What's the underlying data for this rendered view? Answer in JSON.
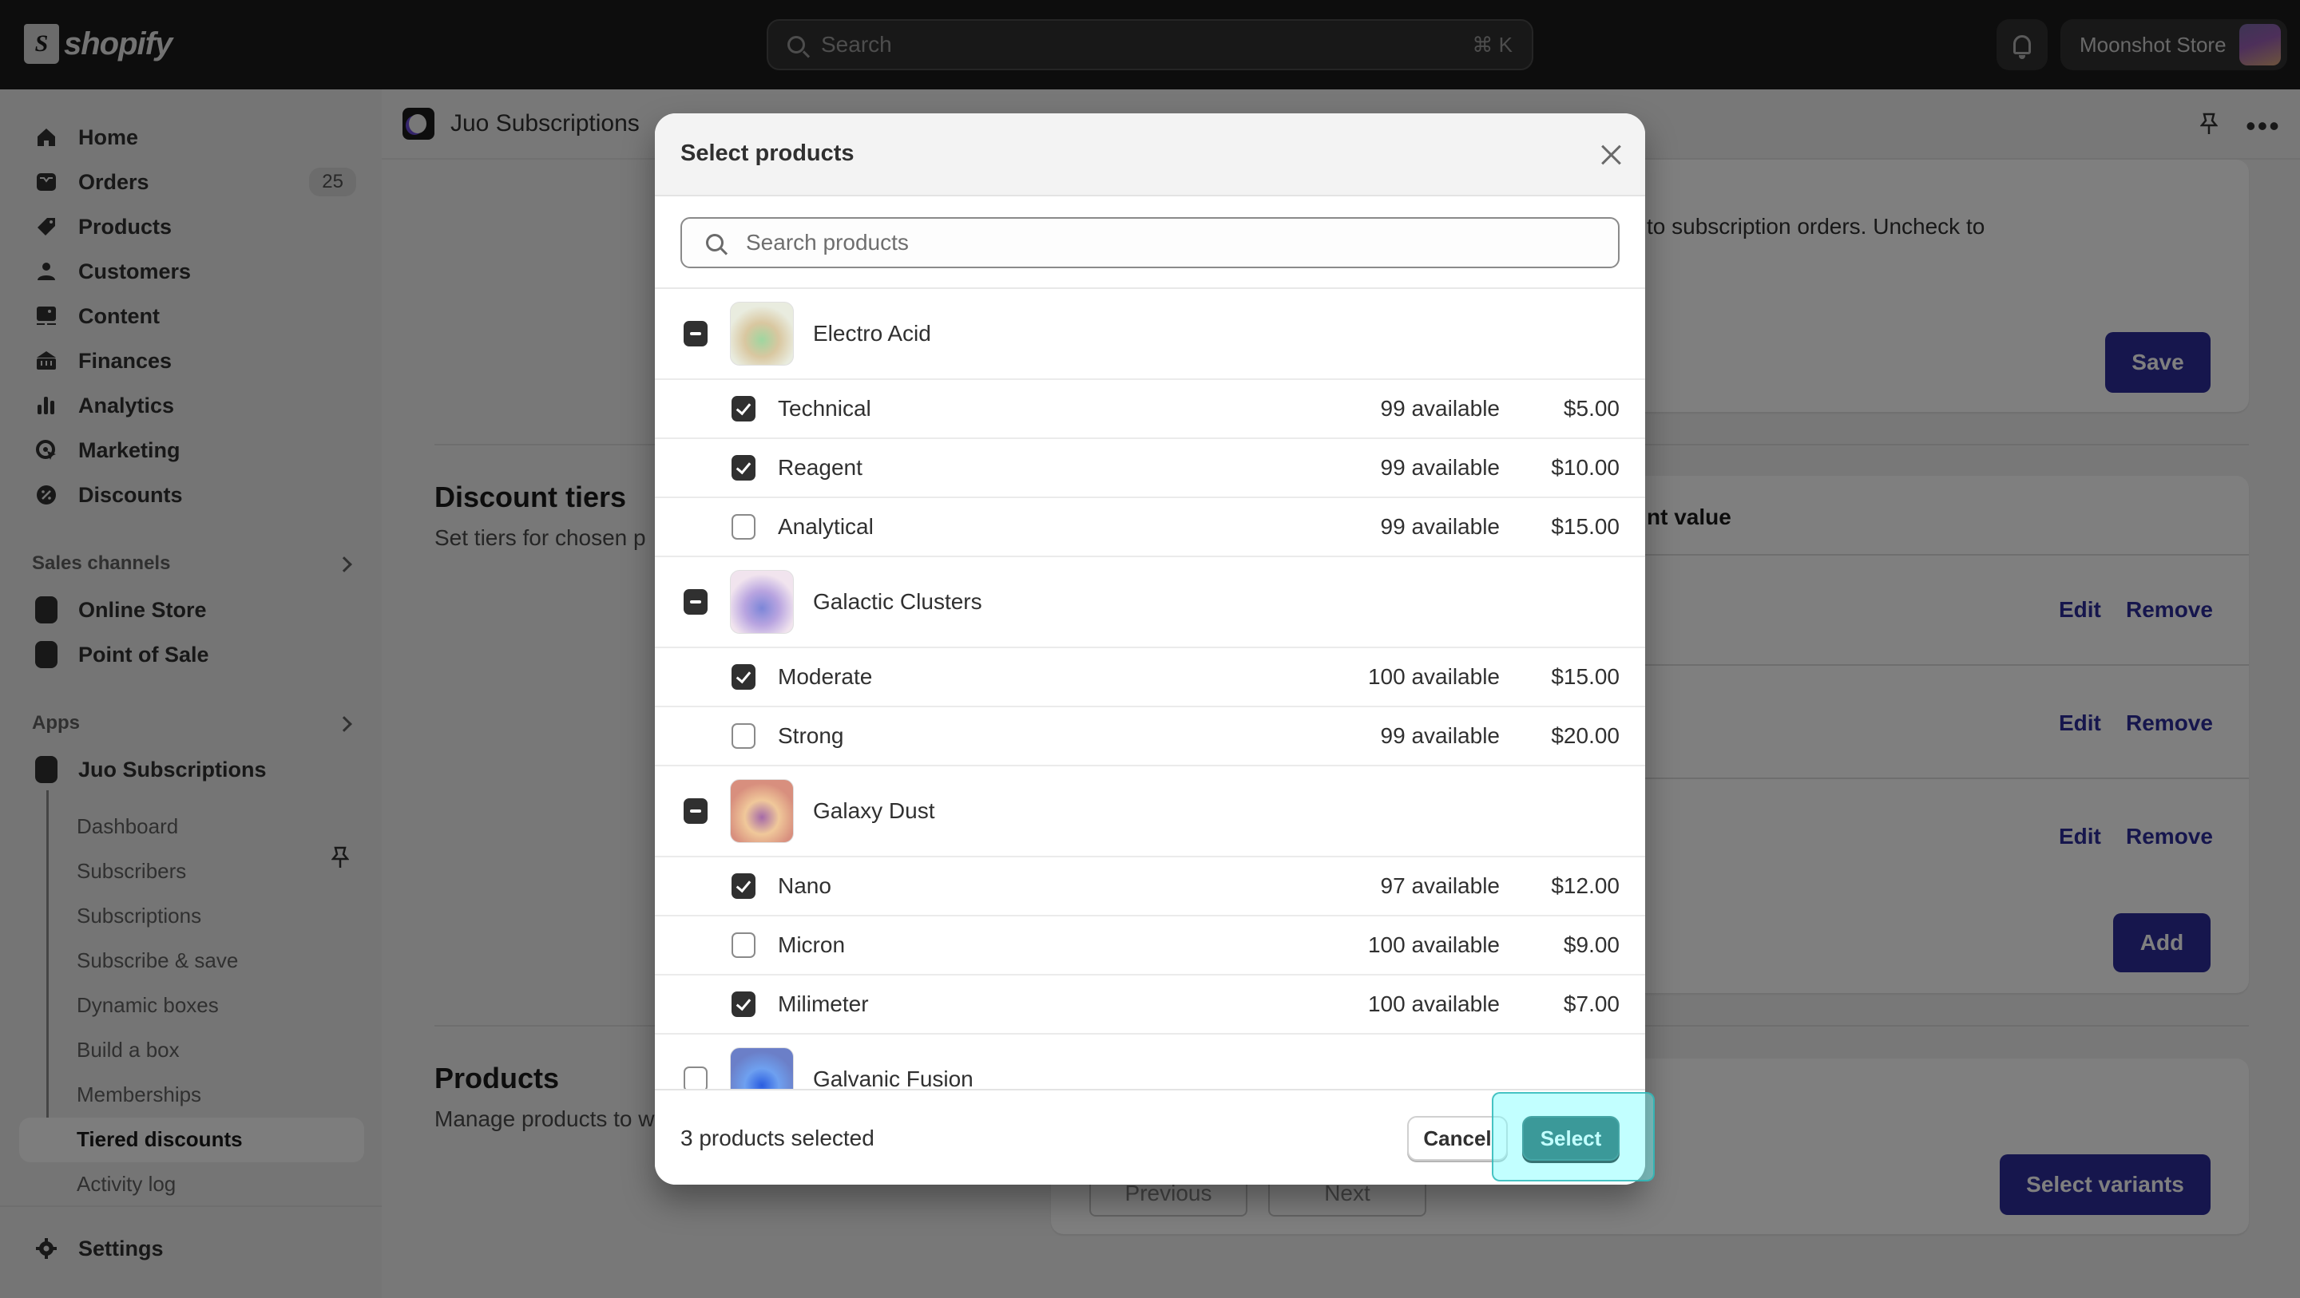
{
  "topbar": {
    "logo_text": "shopify",
    "search_placeholder": "Search",
    "search_shortcut": "⌘ K",
    "store_name": "Moonshot Store"
  },
  "sidebar": {
    "main_items": [
      {
        "label": "Home",
        "icon": "home-icon"
      },
      {
        "label": "Orders",
        "icon": "inbox-icon",
        "badge": "25"
      },
      {
        "label": "Products",
        "icon": "tag-icon"
      },
      {
        "label": "Customers",
        "icon": "person-icon"
      },
      {
        "label": "Content",
        "icon": "image-icon"
      },
      {
        "label": "Finances",
        "icon": "bank-icon"
      },
      {
        "label": "Analytics",
        "icon": "bar-chart-icon"
      },
      {
        "label": "Marketing",
        "icon": "target-icon"
      },
      {
        "label": "Discounts",
        "icon": "discount-icon"
      }
    ],
    "sales_channels_title": "Sales channels",
    "sales_channels": [
      {
        "label": "Online Store",
        "icon": "store-icon"
      },
      {
        "label": "Point of Sale",
        "icon": "pos-icon"
      }
    ],
    "apps_title": "Apps",
    "app": {
      "label": "Juo Subscriptions",
      "sub_items": [
        "Dashboard",
        "Subscribers",
        "Subscriptions",
        "Subscribe & save",
        "Dynamic boxes",
        "Build a box",
        "Memberships",
        "Tiered discounts",
        "Activity log"
      ],
      "active": "Tiered discounts"
    },
    "settings_label": "Settings"
  },
  "page": {
    "app_title": "Juo Subscriptions",
    "top_card_text": "to subscription orders. Uncheck to",
    "save_label": "Save",
    "discount_tiers": {
      "title": "Discount tiers",
      "description": "Set tiers for chosen p",
      "column_header": "nt value",
      "rows": [
        {
          "edit": "Edit",
          "remove": "Remove"
        },
        {
          "edit": "Edit",
          "remove": "Remove"
        },
        {
          "edit": "Edit",
          "remove": "Remove"
        }
      ],
      "add_label": "Add"
    },
    "products": {
      "title": "Products",
      "description": "Manage products to w",
      "previous_label": "Previous",
      "next_label": "Next",
      "select_variants_label": "Select variants"
    }
  },
  "modal": {
    "title": "Select products",
    "search_placeholder": "Search products",
    "products": [
      {
        "name": "Electro Acid",
        "state": "mixed",
        "thumb_colors": [
          "#e9ecdf",
          "#9fd6a0",
          "#d9c7a0"
        ],
        "variants": [
          {
            "name": "Technical",
            "available": "99 available",
            "price": "$5.00",
            "checked": true
          },
          {
            "name": "Reagent",
            "available": "99 available",
            "price": "$10.00",
            "checked": true
          },
          {
            "name": "Analytical",
            "available": "99 available",
            "price": "$15.00",
            "checked": false
          }
        ]
      },
      {
        "name": "Galactic Clusters",
        "state": "mixed",
        "thumb_colors": [
          "#f1e4ee",
          "#7c86d8",
          "#b8a4e0"
        ],
        "variants": [
          {
            "name": "Moderate",
            "available": "100 available",
            "price": "$15.00",
            "checked": true
          },
          {
            "name": "Strong",
            "available": "99 available",
            "price": "$20.00",
            "checked": false
          }
        ]
      },
      {
        "name": "Galaxy Dust",
        "state": "mixed",
        "thumb_colors": [
          "#d88f7e",
          "#a56aa8",
          "#f0c89a"
        ],
        "variants": [
          {
            "name": "Nano",
            "available": "97 available",
            "price": "$12.00",
            "checked": true
          },
          {
            "name": "Micron",
            "available": "100 available",
            "price": "$9.00",
            "checked": false
          },
          {
            "name": "Milimeter",
            "available": "100 available",
            "price": "$7.00",
            "checked": true
          }
        ]
      },
      {
        "name": "Galvanic Fusion",
        "state": "unchecked",
        "thumb_colors": [
          "#6b7fc8",
          "#2a5de0",
          "#6ea0f0"
        ],
        "variants": []
      }
    ],
    "selected_count_text": "3 products selected",
    "cancel_label": "Cancel",
    "select_label": "Select"
  },
  "colors": {
    "primary_button": "#2c2c9b",
    "select_button": "#0a4545",
    "topbar": "#1a1a1a",
    "highlight": "#78ffff"
  }
}
